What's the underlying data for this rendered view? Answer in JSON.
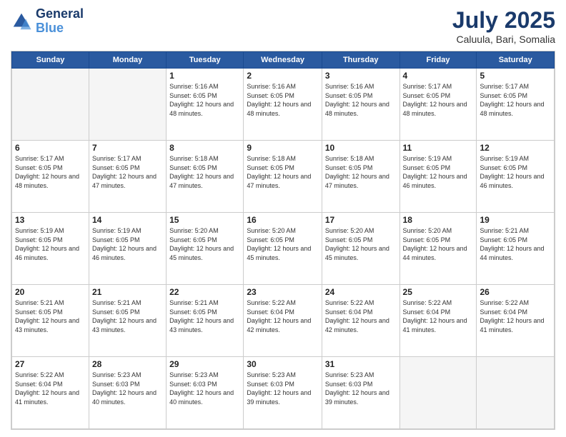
{
  "logo": {
    "line1": "General",
    "line2": "Blue"
  },
  "header": {
    "month": "July 2025",
    "location": "Caluula, Bari, Somalia"
  },
  "weekdays": [
    "Sunday",
    "Monday",
    "Tuesday",
    "Wednesday",
    "Thursday",
    "Friday",
    "Saturday"
  ],
  "weeks": [
    [
      {
        "day": null,
        "info": null
      },
      {
        "day": null,
        "info": null
      },
      {
        "day": "1",
        "info": "Sunrise: 5:16 AM\nSunset: 6:05 PM\nDaylight: 12 hours and 48 minutes."
      },
      {
        "day": "2",
        "info": "Sunrise: 5:16 AM\nSunset: 6:05 PM\nDaylight: 12 hours and 48 minutes."
      },
      {
        "day": "3",
        "info": "Sunrise: 5:16 AM\nSunset: 6:05 PM\nDaylight: 12 hours and 48 minutes."
      },
      {
        "day": "4",
        "info": "Sunrise: 5:17 AM\nSunset: 6:05 PM\nDaylight: 12 hours and 48 minutes."
      },
      {
        "day": "5",
        "info": "Sunrise: 5:17 AM\nSunset: 6:05 PM\nDaylight: 12 hours and 48 minutes."
      }
    ],
    [
      {
        "day": "6",
        "info": "Sunrise: 5:17 AM\nSunset: 6:05 PM\nDaylight: 12 hours and 48 minutes."
      },
      {
        "day": "7",
        "info": "Sunrise: 5:17 AM\nSunset: 6:05 PM\nDaylight: 12 hours and 47 minutes."
      },
      {
        "day": "8",
        "info": "Sunrise: 5:18 AM\nSunset: 6:05 PM\nDaylight: 12 hours and 47 minutes."
      },
      {
        "day": "9",
        "info": "Sunrise: 5:18 AM\nSunset: 6:05 PM\nDaylight: 12 hours and 47 minutes."
      },
      {
        "day": "10",
        "info": "Sunrise: 5:18 AM\nSunset: 6:05 PM\nDaylight: 12 hours and 47 minutes."
      },
      {
        "day": "11",
        "info": "Sunrise: 5:19 AM\nSunset: 6:05 PM\nDaylight: 12 hours and 46 minutes."
      },
      {
        "day": "12",
        "info": "Sunrise: 5:19 AM\nSunset: 6:05 PM\nDaylight: 12 hours and 46 minutes."
      }
    ],
    [
      {
        "day": "13",
        "info": "Sunrise: 5:19 AM\nSunset: 6:05 PM\nDaylight: 12 hours and 46 minutes."
      },
      {
        "day": "14",
        "info": "Sunrise: 5:19 AM\nSunset: 6:05 PM\nDaylight: 12 hours and 46 minutes."
      },
      {
        "day": "15",
        "info": "Sunrise: 5:20 AM\nSunset: 6:05 PM\nDaylight: 12 hours and 45 minutes."
      },
      {
        "day": "16",
        "info": "Sunrise: 5:20 AM\nSunset: 6:05 PM\nDaylight: 12 hours and 45 minutes."
      },
      {
        "day": "17",
        "info": "Sunrise: 5:20 AM\nSunset: 6:05 PM\nDaylight: 12 hours and 45 minutes."
      },
      {
        "day": "18",
        "info": "Sunrise: 5:20 AM\nSunset: 6:05 PM\nDaylight: 12 hours and 44 minutes."
      },
      {
        "day": "19",
        "info": "Sunrise: 5:21 AM\nSunset: 6:05 PM\nDaylight: 12 hours and 44 minutes."
      }
    ],
    [
      {
        "day": "20",
        "info": "Sunrise: 5:21 AM\nSunset: 6:05 PM\nDaylight: 12 hours and 43 minutes."
      },
      {
        "day": "21",
        "info": "Sunrise: 5:21 AM\nSunset: 6:05 PM\nDaylight: 12 hours and 43 minutes."
      },
      {
        "day": "22",
        "info": "Sunrise: 5:21 AM\nSunset: 6:05 PM\nDaylight: 12 hours and 43 minutes."
      },
      {
        "day": "23",
        "info": "Sunrise: 5:22 AM\nSunset: 6:04 PM\nDaylight: 12 hours and 42 minutes."
      },
      {
        "day": "24",
        "info": "Sunrise: 5:22 AM\nSunset: 6:04 PM\nDaylight: 12 hours and 42 minutes."
      },
      {
        "day": "25",
        "info": "Sunrise: 5:22 AM\nSunset: 6:04 PM\nDaylight: 12 hours and 41 minutes."
      },
      {
        "day": "26",
        "info": "Sunrise: 5:22 AM\nSunset: 6:04 PM\nDaylight: 12 hours and 41 minutes."
      }
    ],
    [
      {
        "day": "27",
        "info": "Sunrise: 5:22 AM\nSunset: 6:04 PM\nDaylight: 12 hours and 41 minutes."
      },
      {
        "day": "28",
        "info": "Sunrise: 5:23 AM\nSunset: 6:03 PM\nDaylight: 12 hours and 40 minutes."
      },
      {
        "day": "29",
        "info": "Sunrise: 5:23 AM\nSunset: 6:03 PM\nDaylight: 12 hours and 40 minutes."
      },
      {
        "day": "30",
        "info": "Sunrise: 5:23 AM\nSunset: 6:03 PM\nDaylight: 12 hours and 39 minutes."
      },
      {
        "day": "31",
        "info": "Sunrise: 5:23 AM\nSunset: 6:03 PM\nDaylight: 12 hours and 39 minutes."
      },
      {
        "day": null,
        "info": null
      },
      {
        "day": null,
        "info": null
      }
    ]
  ]
}
